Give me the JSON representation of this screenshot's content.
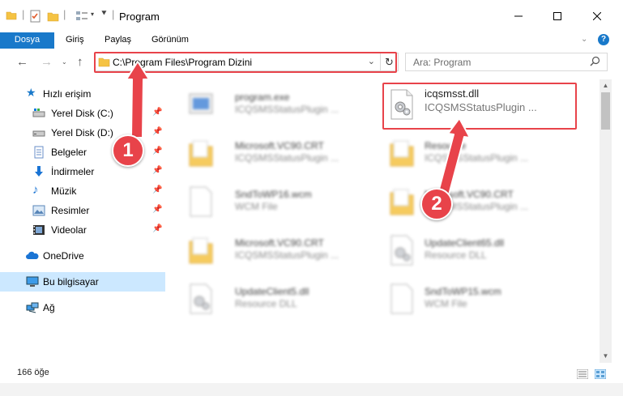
{
  "window": {
    "title": "Program",
    "minimize": "—",
    "maximize": "☐",
    "close": "✕"
  },
  "ribbon": {
    "tabs": [
      "Dosya",
      "Giriş",
      "Paylaş",
      "Görünüm"
    ]
  },
  "address": {
    "path": "C:\\Program Files\\Program Dizini",
    "search_placeholder": "Ara: Program"
  },
  "nav": {
    "quick_access": "Hızlı erişim",
    "items": [
      {
        "label": "Yerel Disk (C:)",
        "icon": "drive-icon"
      },
      {
        "label": "Yerel Disk (D:)",
        "icon": "drive-icon"
      },
      {
        "label": "Belgeler",
        "icon": "documents-icon"
      },
      {
        "label": "İndirmeler",
        "icon": "downloads-icon"
      },
      {
        "label": "Müzik",
        "icon": "music-icon"
      },
      {
        "label": "Resimler",
        "icon": "pictures-icon"
      },
      {
        "label": "Videolar",
        "icon": "videos-icon"
      }
    ],
    "onedrive": "OneDrive",
    "this_pc": "Bu bilgisayar",
    "network": "Ağ"
  },
  "files": [
    {
      "name": "program.exe",
      "type": "ICQSMSStatusPlugin ..."
    },
    {
      "name": "icqsmsst.dll",
      "type": "ICQSMSStatusPlugin ..."
    },
    {
      "name": "Microsoft.VC90.CRT",
      "type": "ICQSMSStatusPlugin ..."
    },
    {
      "name": "Resource",
      "type": "ICQSMSStatusPlugin ..."
    },
    {
      "name": "SndToWP16.wcm",
      "type": "WCM File"
    },
    {
      "name": "Microsoft.VC90.CRT",
      "type": "ICQSMSStatusPlugin ..."
    },
    {
      "name": "Microsoft.VC90.CRT",
      "type": "ICQSMSStatusPlugin ..."
    },
    {
      "name": "UpdateClient65.dll",
      "type": "Resource DLL"
    },
    {
      "name": "UpdateClient5.dll",
      "type": "Resource DLL"
    },
    {
      "name": "SndToWP15.wcm",
      "type": "WCM File"
    }
  ],
  "status": {
    "count": "166 öğe"
  },
  "annotations": {
    "step1": "1",
    "step2": "2",
    "color": "#e8434a"
  }
}
